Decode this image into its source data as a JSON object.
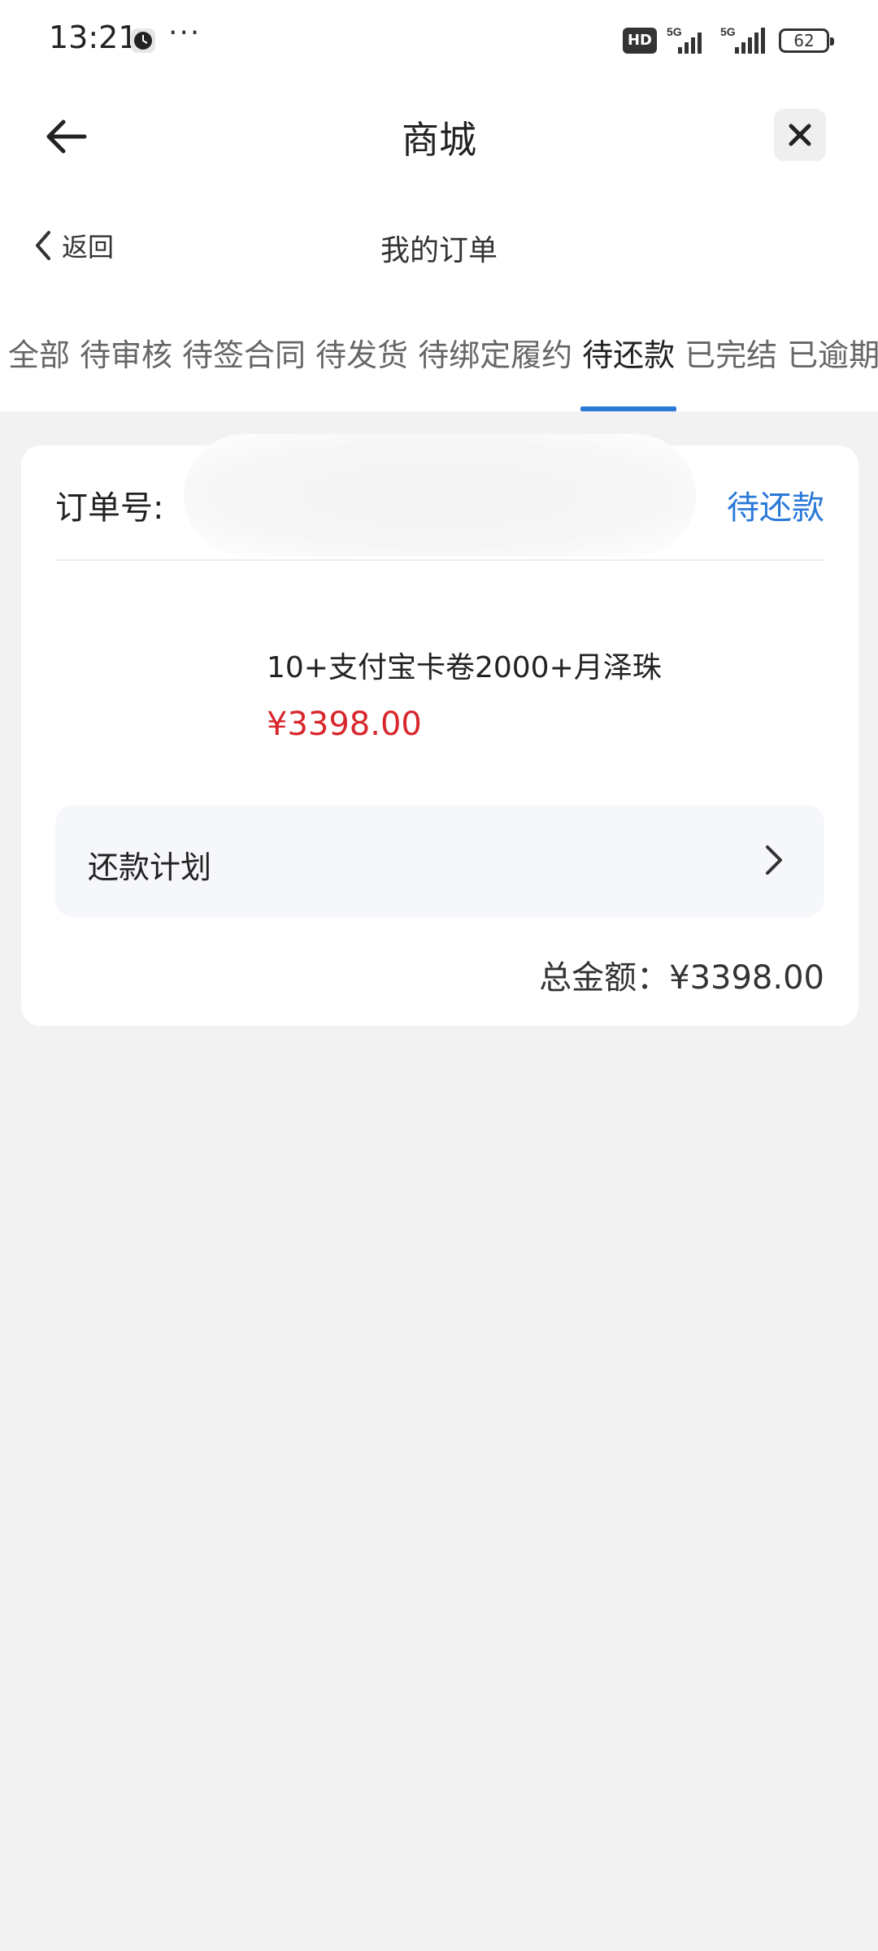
{
  "status_bar": {
    "time": "13:21",
    "dots": "···",
    "hd": "HD",
    "net1": "5G",
    "net2": "5G",
    "battery": "62"
  },
  "app_bar": {
    "title": "商城"
  },
  "sub_header": {
    "back_label": "返回",
    "title": "我的订单"
  },
  "tabs": [
    {
      "label": "全部"
    },
    {
      "label": "待审核"
    },
    {
      "label": "待签合同"
    },
    {
      "label": "待发货"
    },
    {
      "label": "待绑定履约"
    },
    {
      "label": "待还款",
      "active": true
    },
    {
      "label": "已完结"
    },
    {
      "label": "已逾期"
    }
  ],
  "order": {
    "order_no_label": "订单号:",
    "status": "待还款",
    "product_name": "10+支付宝卡卷2000+月泽珠",
    "price": "¥3398.00",
    "plan_label": "还款计划",
    "total": "总金额：¥3398.00"
  },
  "colors": {
    "accent": "#2a7ad8",
    "price_red": "#d8262c",
    "background": "#f2f2f2"
  }
}
